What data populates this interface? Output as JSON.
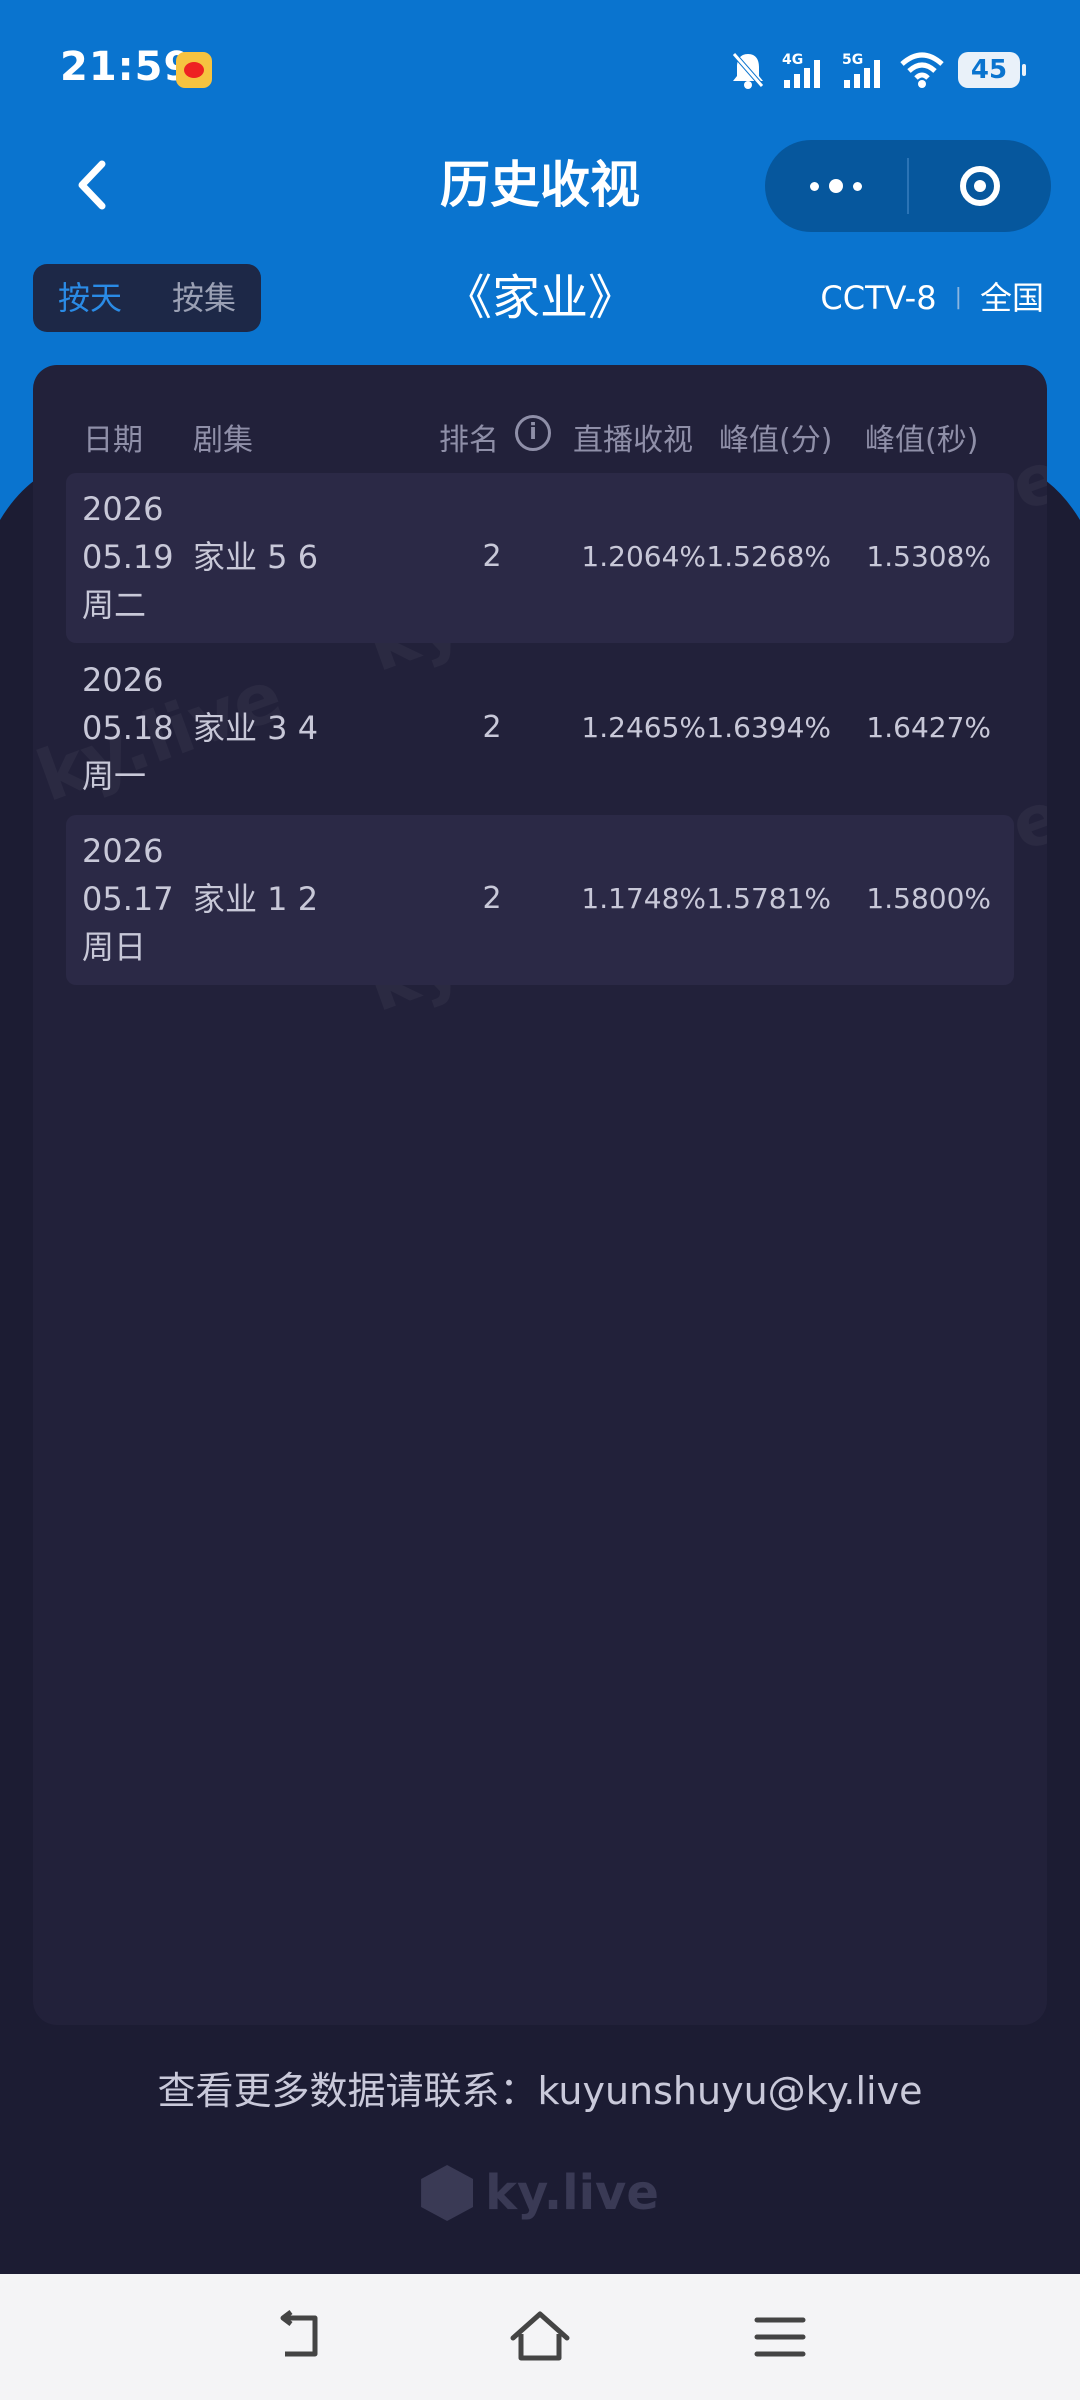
{
  "status_bar": {
    "time": "21:59",
    "battery": "45",
    "network_1": "4G",
    "network_2": "5G",
    "icons": [
      "weibo-icon",
      "bell-muted-icon",
      "signal-4g-icon",
      "signal-5g-icon",
      "wifi-icon",
      "battery-icon"
    ]
  },
  "nav": {
    "title": "历史收视"
  },
  "toolbar": {
    "tab_day": "按天",
    "tab_episode": "按集",
    "drama_title": "《家业》",
    "channel": "CCTV-8",
    "separator": "|",
    "region": "全国"
  },
  "table": {
    "headers": {
      "date": "日期",
      "episode": "剧集",
      "rank": "排名",
      "live": "直播收视",
      "peak_min": "峰值(分)",
      "peak_sec": "峰值(秒)"
    },
    "info_glyph": "i",
    "rows": [
      {
        "year": "2026",
        "md": "05.19",
        "weekday": "周二",
        "episode": "家业 5 6",
        "rank": "2",
        "live": "1.2064%",
        "peak_min": "1.5268%",
        "peak_sec": "1.5308%"
      },
      {
        "year": "2026",
        "md": "05.18",
        "weekday": "周一",
        "episode": "家业 3 4",
        "rank": "2",
        "live": "1.2465%",
        "peak_min": "1.6394%",
        "peak_sec": "1.6427%"
      },
      {
        "year": "2026",
        "md": "05.17",
        "weekday": "周日",
        "episode": "家业 1 2",
        "rank": "2",
        "live": "1.1748%",
        "peak_min": "1.5781%",
        "peak_sec": "1.5800%"
      }
    ]
  },
  "watermark": "ky.live",
  "footer": {
    "contact": "查看更多数据请联系：kuyunshuyu@ky.live",
    "logo_text": "ky.live"
  },
  "colors": {
    "header_blue": "#0a74cf",
    "background": "#1c1c33",
    "active_tab": "#2a8be6"
  }
}
